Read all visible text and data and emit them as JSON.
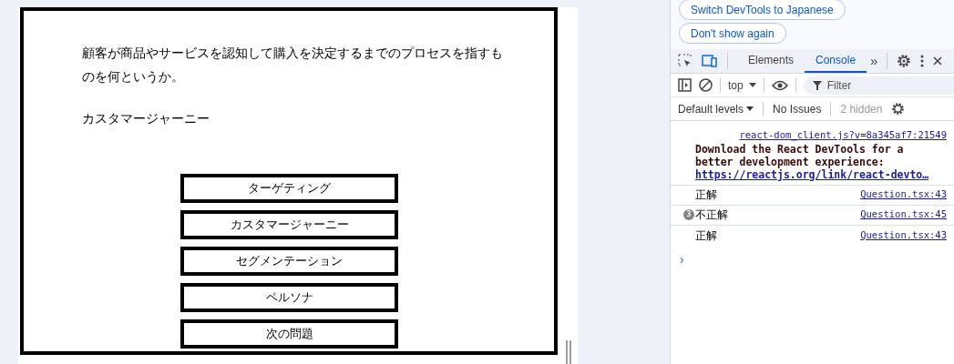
{
  "quiz": {
    "question": "顧客が商品やサービスを認知して購入を決定するまでのプロセスを指すものを何というか。",
    "answer": "カスタマージャーニー",
    "options": [
      "ターゲティング",
      "カスタマージャーニー",
      "セグメンテーション",
      "ペルソナ"
    ],
    "next_button": "次の問題"
  },
  "devtools": {
    "prompt_buttons": [
      "Switch DevTools to Japanese",
      "Don't show again"
    ],
    "tabs": [
      {
        "label": "Elements",
        "selected": false
      },
      {
        "label": "Console",
        "selected": true
      }
    ],
    "more_tabs": "»",
    "context": "top",
    "filter": {
      "placeholder": "Filter"
    },
    "levels": "Default levels",
    "issues": "No Issues",
    "hidden": "2 hidden",
    "messages": [
      {
        "kind": "info",
        "source": "react-dom_client.js?v=8a345af7:21549",
        "text": "Download the React DevTools for a better development experience:",
        "link": "https://reactjs.org/link/react-devto…"
      },
      {
        "kind": "log",
        "text": "正解",
        "source": "Question.tsx:43"
      },
      {
        "kind": "log",
        "count": "3",
        "text": "不正解",
        "source": "Question.tsx:45"
      },
      {
        "kind": "log",
        "text": "正解",
        "source": "Question.tsx:43"
      }
    ],
    "prompt_symbol": "›"
  }
}
